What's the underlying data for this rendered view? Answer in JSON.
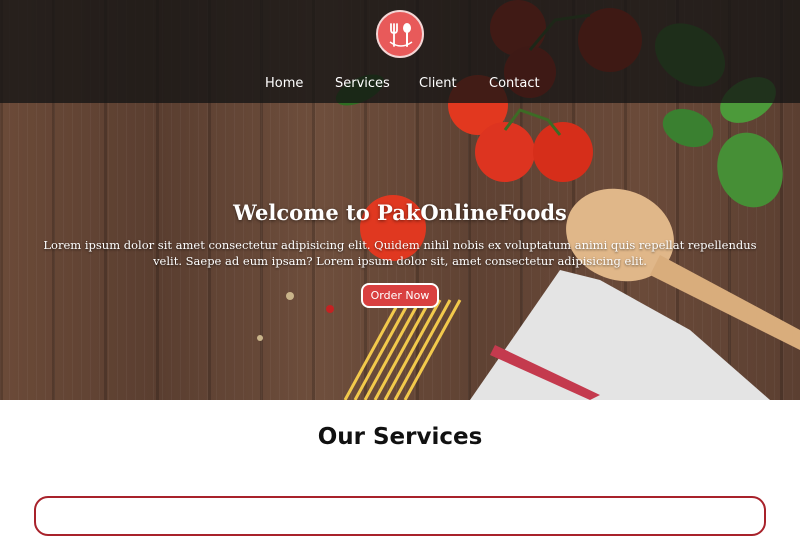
{
  "brand": {
    "logo_icon": "fork-spoon-icon",
    "logo_color": "#e85a5a"
  },
  "nav": {
    "items": [
      {
        "label": "Home"
      },
      {
        "label": "Services"
      },
      {
        "label": "Client"
      },
      {
        "label": "Contact"
      }
    ]
  },
  "hero": {
    "title": "Welcome to PakOnlineFoods",
    "text": "Lorem ipsum dolor sit amet consectetur adipisicing elit. Quidem nihil nobis ex voluptatum animi quis repellat repellendus velit. Saepe ad eum ipsam? Lorem ipsum dolor sit, amet consectetur adipisicing elit.",
    "button_label": "Order Now"
  },
  "services": {
    "title": "Our Services"
  },
  "colors": {
    "accent": "#d94040",
    "card_border": "#a8222b"
  }
}
